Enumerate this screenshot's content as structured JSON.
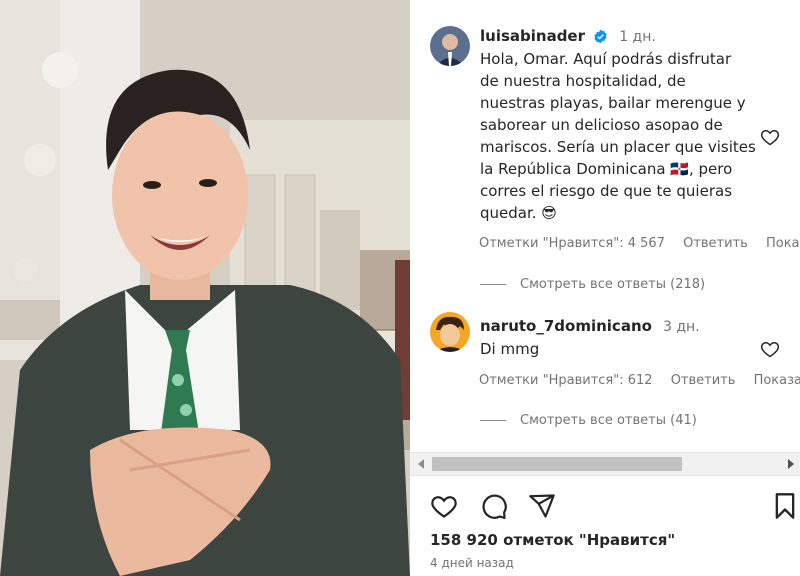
{
  "comments": [
    {
      "username": "luisabinader",
      "verified": true,
      "age": "1 дн.",
      "lines": [
        "Hola, Omar. Aquí podrás disfrutar",
        "de nuestra hospitalidad, de",
        "nuestras playas, bailar merengue y",
        "saborear un delicioso asopao de",
        "mariscos. Sería un placer que visites",
        "la República Dominicana 🇩🇴, pero",
        "corres el riesgo de que te quieras",
        "quedar. 😎"
      ],
      "likes_text": "Отметки \"Нравится\": 4 567",
      "reply_label": "Ответить",
      "show_label": "Показать",
      "view_replies": "Смотреть все ответы (218)"
    },
    {
      "username": "naruto_7dominicano",
      "age": "3 дн.",
      "text": "Di mmg",
      "likes_text": "Отметки \"Нравится\": 612",
      "reply_label": "Ответить",
      "show_label": "Показать",
      "view_replies": "Смотреть все ответы (41)"
    }
  ],
  "post": {
    "likes": "158 920 отметок \"Нравится\"",
    "time_ago": "4 дней назад"
  },
  "colors": {
    "verified": "#0095f6",
    "muted": "#737373",
    "text": "#262626"
  },
  "icons": [
    "heart-icon",
    "comment-icon",
    "share-icon",
    "bookmark-icon",
    "verified-badge-icon"
  ]
}
